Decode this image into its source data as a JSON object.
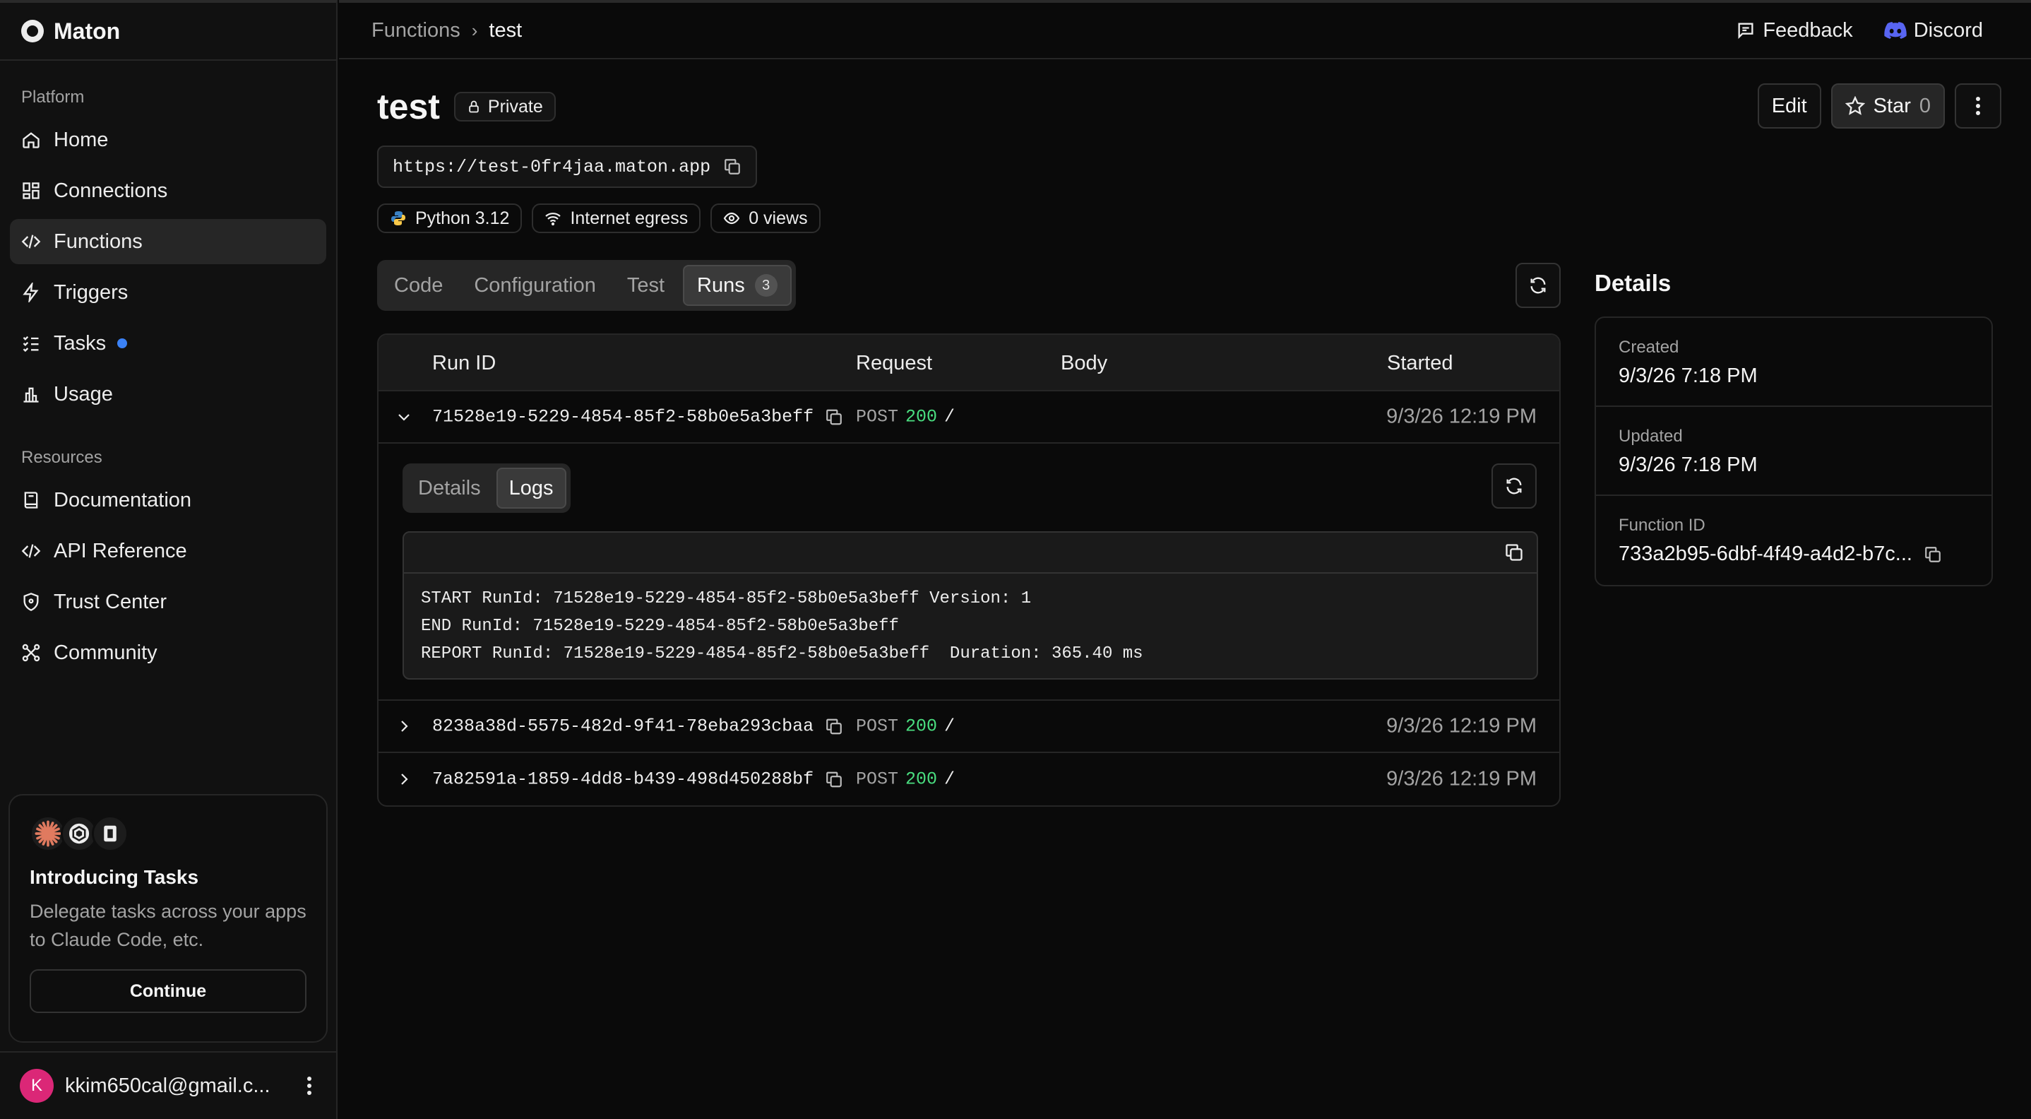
{
  "brand": {
    "name": "Maton"
  },
  "sidebar": {
    "platform_label": "Platform",
    "platform_items": [
      {
        "label": "Home",
        "icon": "home-icon"
      },
      {
        "label": "Connections",
        "icon": "grid-icon"
      },
      {
        "label": "Functions",
        "icon": "code-icon",
        "active": true
      },
      {
        "label": "Triggers",
        "icon": "bolt-icon"
      },
      {
        "label": "Tasks",
        "icon": "list-check-icon",
        "badge_dot": true
      },
      {
        "label": "Usage",
        "icon": "bar-chart-icon"
      }
    ],
    "resources_label": "Resources",
    "resource_items": [
      {
        "label": "Documentation",
        "icon": "book-icon"
      },
      {
        "label": "API Reference",
        "icon": "code-icon"
      },
      {
        "label": "Trust Center",
        "icon": "shield-icon"
      },
      {
        "label": "Community",
        "icon": "community-icon"
      }
    ],
    "promo": {
      "title": "Introducing Tasks",
      "text": "Delegate tasks across your apps to Claude Code, etc.",
      "button": "Continue"
    },
    "user": {
      "initial": "K",
      "email": "kkim650cal@gmail.c..."
    }
  },
  "topbar": {
    "breadcrumb_parent": "Functions",
    "breadcrumb_sep": "›",
    "breadcrumb_current": "test",
    "feedback": "Feedback",
    "discord": "Discord"
  },
  "page": {
    "title": "test",
    "visibility": "Private",
    "url": "https://test-0fr4jaa.maton.app",
    "runtime": "Python 3.12",
    "network": "Internet egress",
    "views": "0 views",
    "edit_label": "Edit",
    "star_label": "Star",
    "star_count": "0"
  },
  "tabs": {
    "code": "Code",
    "configuration": "Configuration",
    "test": "Test",
    "runs": "Runs",
    "runs_count": "3"
  },
  "runs_table": {
    "headers": {
      "run_id": "Run ID",
      "request": "Request",
      "body": "Body",
      "started": "Started"
    },
    "rows": [
      {
        "id": "71528e19-5229-4854-85f2-58b0e5a3beff",
        "method": "POST",
        "status": "200",
        "path": "/",
        "started": "9/3/26 12:19 PM"
      },
      {
        "id": "8238a38d-5575-482d-9f41-78eba293cbaa",
        "method": "POST",
        "status": "200",
        "path": "/",
        "started": "9/3/26 12:19 PM"
      },
      {
        "id": "7a82591a-1859-4dd8-b439-498d450288bf",
        "method": "POST",
        "status": "200",
        "path": "/",
        "started": "9/3/26 12:19 PM"
      }
    ],
    "expanded": {
      "tab_details": "Details",
      "tab_logs": "Logs",
      "log_lines": [
        "START RunId: 71528e19-5229-4854-85f2-58b0e5a3beff Version: 1",
        "END RunId: 71528e19-5229-4854-85f2-58b0e5a3beff",
        "REPORT RunId: 71528e19-5229-4854-85f2-58b0e5a3beff  Duration: 365.40 ms"
      ]
    }
  },
  "details": {
    "title": "Details",
    "created_label": "Created",
    "created_value": "9/3/26 7:18 PM",
    "updated_label": "Updated",
    "updated_value": "9/3/26 7:18 PM",
    "function_id_label": "Function ID",
    "function_id_value": "733a2b95-6dbf-4f49-a4d2-b7c..."
  },
  "colors": {
    "accent_blue": "#3b82f6",
    "status_green": "#4ade80",
    "discord": "#5865f2"
  }
}
